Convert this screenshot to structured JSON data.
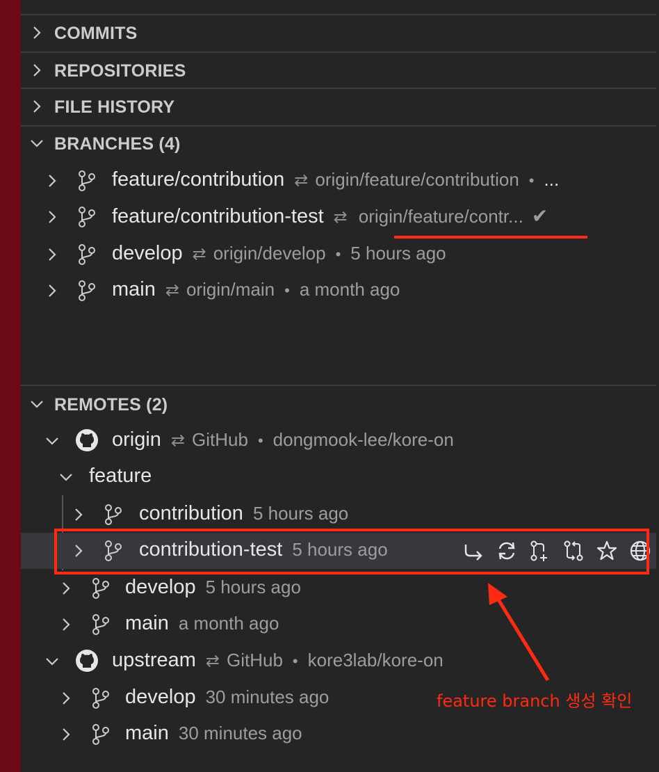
{
  "sections": {
    "commits": "COMMITS",
    "repositories": "REPOSITORIES",
    "file_history": "FILE HISTORY",
    "branches": "BRANCHES (4)",
    "remotes": "REMOTES (2)"
  },
  "branches": [
    {
      "name": "feature/contribution",
      "upstream": "origin/feature/contribution",
      "dot": "•",
      "trail": "...",
      "time": ""
    },
    {
      "name": "feature/contribution-test",
      "upstream": "origin/feature/contr...",
      "status": "✔"
    },
    {
      "name": "develop",
      "upstream": "origin/develop",
      "dot": "•",
      "time": "5 hours ago"
    },
    {
      "name": "main",
      "upstream": "origin/main",
      "dot": "•",
      "time": "a month ago"
    }
  ],
  "remotes": {
    "origin": {
      "name": "origin",
      "provider": "GitHub",
      "repo": "dongmook-lee/kore-on",
      "folder": "feature",
      "feature_branches": [
        {
          "name": "contribution",
          "time": "5 hours ago"
        },
        {
          "name": "contribution-test",
          "time": "5 hours ago"
        }
      ],
      "branches": [
        {
          "name": "develop",
          "time": "5 hours ago"
        },
        {
          "name": "main",
          "time": "a month ago"
        }
      ]
    },
    "upstream": {
      "name": "upstream",
      "provider": "GitHub",
      "repo": "kore3lab/kore-on",
      "branches": [
        {
          "name": "develop",
          "time": "30 minutes ago"
        },
        {
          "name": "main",
          "time": "30 minutes ago"
        }
      ]
    }
  },
  "symbols": {
    "tracking": "⇄",
    "dot": "•"
  },
  "annotation": "feature branch 생성 확인",
  "colors": {
    "accent_red": "#ff2a12",
    "sidebar_red": "#6b0a14",
    "background": "#252526",
    "highlight": "#37373d"
  }
}
